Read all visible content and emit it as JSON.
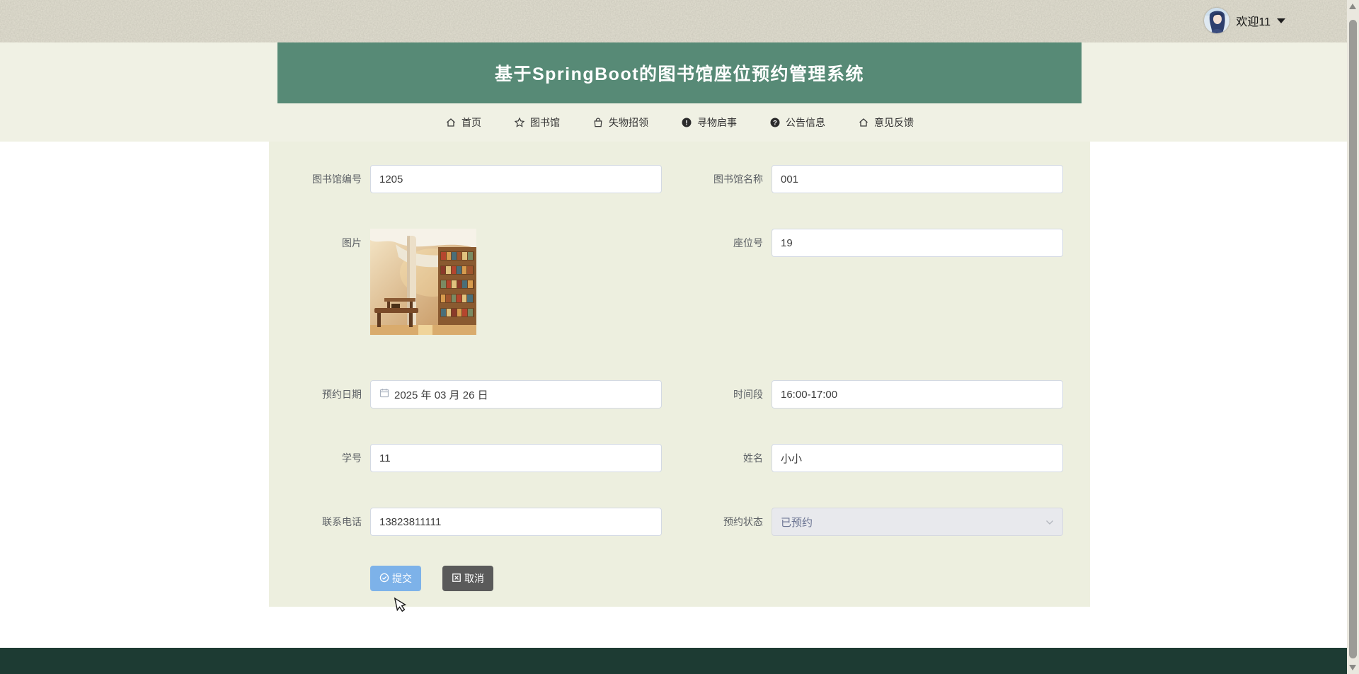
{
  "topbar": {
    "welcome": "欢迎11"
  },
  "header": {
    "title": "基于SpringBoot的图书馆座位预约管理系统"
  },
  "nav": {
    "items": [
      {
        "label": "首页",
        "icon": "home-icon"
      },
      {
        "label": "图书馆",
        "icon": "star-icon"
      },
      {
        "label": "失物招领",
        "icon": "bag-icon"
      },
      {
        "label": "寻物启事",
        "icon": "info-circle-icon",
        "glyph": "!"
      },
      {
        "label": "公告信息",
        "icon": "question-circle-icon",
        "glyph": "?"
      },
      {
        "label": "意见反馈",
        "icon": "home-icon"
      }
    ]
  },
  "form": {
    "fields": {
      "library_no": {
        "label": "图书馆编号",
        "value": "1205"
      },
      "library_name": {
        "label": "图书馆名称",
        "value": "001"
      },
      "picture": {
        "label": "图片"
      },
      "seat_no": {
        "label": "座位号",
        "value": "19"
      },
      "reserve_date": {
        "label": "预约日期",
        "value": "2025 年 03 月 26 日"
      },
      "time_slot": {
        "label": "时间段",
        "value": "16:00-17:00"
      },
      "student_no": {
        "label": "学号",
        "value": "11"
      },
      "student_name": {
        "label": "姓名",
        "value": "小小"
      },
      "phone": {
        "label": "联系电话",
        "value": "13823811111"
      },
      "status": {
        "label": "预约状态",
        "value": "已预约"
      }
    },
    "buttons": {
      "submit": "提交",
      "cancel": "取消"
    }
  },
  "colors": {
    "banner_green": "#578a76",
    "footer_green": "#1d3b33",
    "header_cream": "#f0f1e4",
    "panel_cream": "#edefdf",
    "topbar_beige": "#e3e0d2",
    "submit_blue": "#7db2e9",
    "cancel_gray": "#5a5a5a",
    "input_border": "#d3d9e3",
    "disabled_select_bg": "#e8e9ed"
  }
}
